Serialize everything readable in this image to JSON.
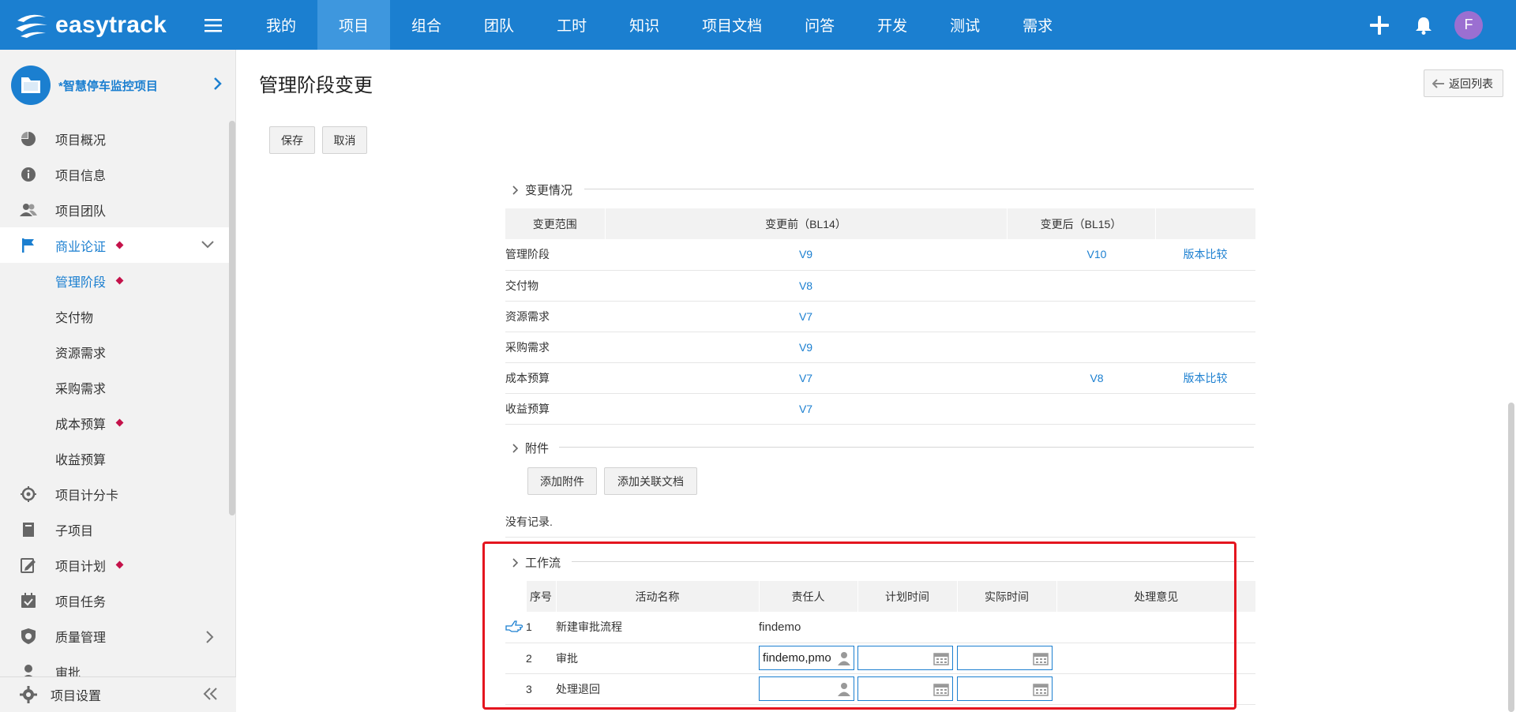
{
  "app": {
    "logo_text": "easytrack"
  },
  "nav": [
    "我的",
    "项目",
    "组合",
    "团队",
    "工时",
    "知识",
    "项目文档",
    "问答",
    "开发",
    "测试",
    "需求"
  ],
  "user": {
    "avatar_letter": "F"
  },
  "sidebar": {
    "project_name": "*智慧停车监控项目",
    "items": [
      {
        "label": "项目概况",
        "icon": "pie-chart-icon"
      },
      {
        "label": "项目信息",
        "icon": "info-icon"
      },
      {
        "label": "项目团队",
        "icon": "team-icon"
      },
      {
        "label": "商业论证",
        "icon": "flag-icon",
        "dot": true,
        "expanded": true
      },
      {
        "label": "管理阶段",
        "sub": true,
        "dot": true,
        "active": true
      },
      {
        "label": "交付物",
        "sub": true
      },
      {
        "label": "资源需求",
        "sub": true
      },
      {
        "label": "采购需求",
        "sub": true
      },
      {
        "label": "成本预算",
        "sub": true,
        "dot": true
      },
      {
        "label": "收益预算",
        "sub": true
      },
      {
        "label": "项目计分卡",
        "icon": "target-icon"
      },
      {
        "label": "子项目",
        "icon": "book-icon"
      },
      {
        "label": "项目计划",
        "icon": "plan-icon",
        "dot": true
      },
      {
        "label": "项目任务",
        "icon": "task-icon"
      },
      {
        "label": "质量管理",
        "icon": "shield-icon",
        "has_arrow": true
      },
      {
        "label": "审批",
        "icon": "person-icon"
      }
    ],
    "footer_label": "项目设置"
  },
  "page": {
    "title": "管理阶段变更",
    "back_label": "返回列表",
    "save_label": "保存",
    "cancel_label": "取消"
  },
  "changes": {
    "section_title": "变更情况",
    "headers": [
      "变更范围",
      "变更前（BL14）",
      "变更后（BL15）",
      ""
    ],
    "rows": [
      {
        "scope": "管理阶段",
        "before": "V9",
        "after": "V10",
        "compare": "版本比较"
      },
      {
        "scope": "交付物",
        "before": "V8",
        "after": "",
        "compare": ""
      },
      {
        "scope": "资源需求",
        "before": "V7",
        "after": "",
        "compare": ""
      },
      {
        "scope": "采购需求",
        "before": "V9",
        "after": "",
        "compare": ""
      },
      {
        "scope": "成本预算",
        "before": "V7",
        "after": "V8",
        "compare": "版本比较"
      },
      {
        "scope": "收益预算",
        "before": "V7",
        "after": "",
        "compare": ""
      }
    ]
  },
  "attachments": {
    "section_title": "附件",
    "add_attachment_label": "添加附件",
    "add_doc_label": "添加关联文档",
    "empty_text": "没有记录."
  },
  "workflow": {
    "section_title": "工作流",
    "headers": [
      "序号",
      "活动名称",
      "责任人",
      "计划时间",
      "实际时间",
      "处理意见"
    ],
    "rows": [
      {
        "no": "1",
        "name": "新建审批流程",
        "owner": "findemo",
        "editable": false,
        "current": true
      },
      {
        "no": "2",
        "name": "审批",
        "owner": "findemo,pmo",
        "editable": true
      },
      {
        "no": "3",
        "name": "处理退回",
        "owner": "",
        "editable": true
      }
    ]
  },
  "colors": {
    "brand": "#1b7fd0",
    "active_nav": "#3e97de",
    "highlight_box": "#e4151f",
    "marker": "#c4124a"
  }
}
